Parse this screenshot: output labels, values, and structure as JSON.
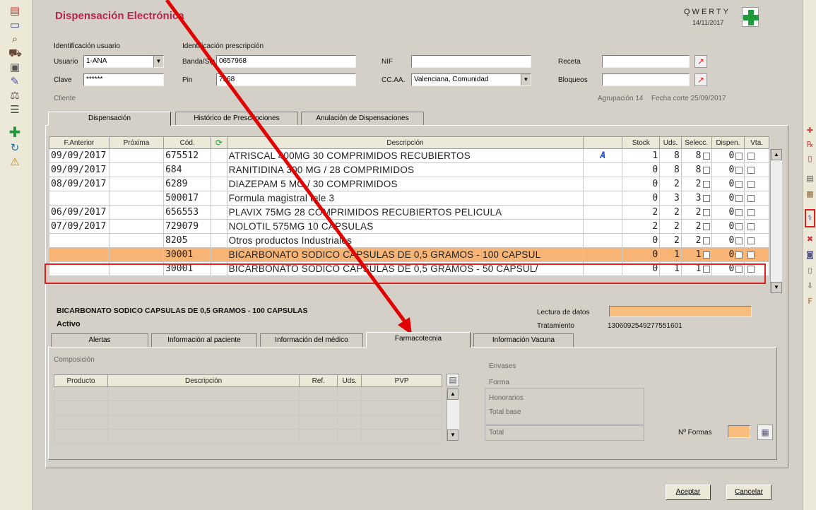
{
  "header": {
    "title": "Dispensación Electrónica",
    "app_code": "QWERTY",
    "date": "14/11/2017"
  },
  "user_section": {
    "label": "Identificación usuario",
    "user_label": "Usuario",
    "user_value": "1-ANA",
    "password_label": "Clave",
    "password_value": "******"
  },
  "prescription_section": {
    "label": "Identificación prescripción",
    "banda_label": "Banda/Sip",
    "banda_value": "0657968",
    "pin_label": "Pin",
    "pin_value": "7968",
    "nif_label": "NIF",
    "nif_value": "",
    "ccaa_label": "CC.AA.",
    "ccaa_value": "Valenciana, Comunidad",
    "receta_label": "Receta",
    "receta_value": "",
    "bloqueos_label": "Bloqueos",
    "bloqueos_value": ""
  },
  "client": {
    "label": "Cliente",
    "agrupacion": "Agrupación 14",
    "fecha_corte": "Fecha corte 25/09/2017"
  },
  "main_tabs": [
    "Dispensación",
    "Histórico de Prescripciones",
    "Anulación de Dispensaciones"
  ],
  "grid": {
    "columns": [
      "F.Anterior",
      "Próxima",
      "Cód.",
      "",
      "Descripción",
      "",
      "Stock",
      "Uds.",
      "Selecc.",
      "Dispen.",
      "Vta."
    ],
    "rows": [
      {
        "prev": "09/09/2017",
        "next": "",
        "code": "675512",
        "desc": "ATRISCAL 400MG 30 COMPRIMIDOS RECUBIERTOS",
        "flag": "A",
        "stock": "1",
        "uds": "8",
        "sel": "8",
        "disp": "0"
      },
      {
        "prev": "09/09/2017",
        "next": "",
        "code": "684",
        "desc": "RANITIDINA 300 MG / 28 COMPRIMIDOS",
        "flag": "",
        "stock": "0",
        "uds": "8",
        "sel": "8",
        "disp": "0"
      },
      {
        "prev": "08/09/2017",
        "next": "",
        "code": "6289",
        "desc": "DIAZEPAM 5 MG / 30 COMPRIMIDOS",
        "flag": "",
        "stock": "0",
        "uds": "2",
        "sel": "2",
        "disp": "0"
      },
      {
        "prev": "",
        "next": "",
        "code": "500017",
        "desc": "Formula magistral tele 3",
        "flag": "",
        "stock": "0",
        "uds": "3",
        "sel": "3",
        "disp": "0"
      },
      {
        "prev": "06/09/2017",
        "next": "",
        "code": "656553",
        "desc": "PLAVIX 75MG 28 COMPRIMIDOS RECUBIERTOS PELICULA",
        "flag": "",
        "stock": "2",
        "uds": "2",
        "sel": "2",
        "disp": "0"
      },
      {
        "prev": "07/09/2017",
        "next": "",
        "code": "729079",
        "desc": "NOLOTIL 575MG 10 CAPSULAS",
        "flag": "",
        "stock": "2",
        "uds": "2",
        "sel": "2",
        "disp": "0"
      },
      {
        "prev": "",
        "next": "",
        "code": "8205",
        "desc": "Otros productos Industriales",
        "flag": "",
        "stock": "0",
        "uds": "2",
        "sel": "2",
        "disp": "0"
      },
      {
        "prev": "",
        "next": "",
        "code": "30001",
        "desc": "BICARBONATO SODICO CAPSULAS DE  0,5 GRAMOS - 100 CAPSUL",
        "flag": "",
        "stock": "0",
        "uds": "1",
        "sel": "1",
        "disp": "0"
      },
      {
        "prev": "",
        "next": "",
        "code": "30001",
        "desc": "BICARBONATO SODICO CAPSULAS DE  0,5 GRAMOS - 50 CAPSUL/",
        "flag": "",
        "stock": "0",
        "uds": "1",
        "sel": "1",
        "disp": "0"
      }
    ]
  },
  "detail": {
    "product": "BICARBONATO SODICO CAPSULAS DE 0,5 GRAMOS - 100 CAPSULAS",
    "status": "Activo",
    "lectura_label": "Lectura de datos",
    "tratamiento_label": "Tratamiento",
    "tratamiento_value": "1306092549277551601"
  },
  "sub_tabs": [
    "Alertas",
    "Información al paciente",
    "Información del médico",
    "Farmacotecnia",
    "Información Vacuna"
  ],
  "farmacotecnia": {
    "composicion_label": "Composición",
    "columns": [
      "Producto",
      "Descripción",
      "Ref.",
      "Uds.",
      "PVP"
    ],
    "envases_label": "Envases",
    "forma_label": "Forma",
    "honorarios_label": "Honorarios",
    "total_base_label": "Total base",
    "total_label": "Total",
    "n_formas_label": "Nº Formas"
  },
  "buttons": {
    "accept": "Aceptar",
    "cancel": "Cancelar"
  },
  "colors": {
    "title": "#b5274a",
    "highlight_row": "#f8b475",
    "annotation": "#e02020"
  }
}
